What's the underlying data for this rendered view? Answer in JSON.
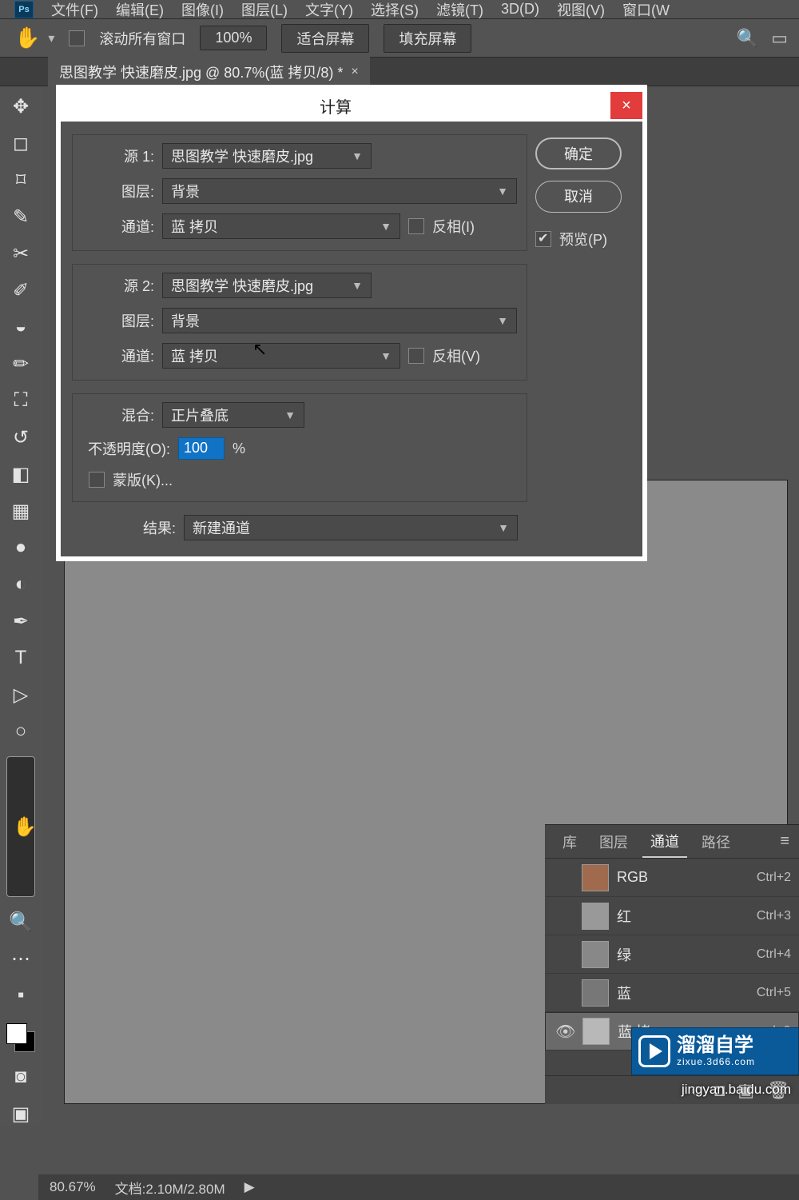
{
  "menubar": [
    "文件(F)",
    "编辑(E)",
    "图像(I)",
    "图层(L)",
    "文字(Y)",
    "选择(S)",
    "滤镜(T)",
    "3D(D)",
    "视图(V)",
    "窗口(W"
  ],
  "optbar": {
    "scroll_all": "滚动所有窗口",
    "zoom": "100%",
    "fit": "适合屏幕",
    "fill": "填充屏幕"
  },
  "doctab": {
    "title": "思图教学 快速磨皮.jpg @ 80.7%(蓝 拷贝/8) *",
    "close": "×"
  },
  "dialog": {
    "title": "计算",
    "close": "×",
    "source1_label": "源 1:",
    "source2_label": "源 2:",
    "source_file": "思图教学 快速磨皮.jpg",
    "layer_label": "图层:",
    "layer_value": "背景",
    "channel_label": "通道:",
    "channel_value": "蓝 拷贝",
    "invert1": "反相(I)",
    "invert2": "反相(V)",
    "blend_label": "混合:",
    "blend_value": "正片叠底",
    "opacity_label": "不透明度(O):",
    "opacity_value": "100",
    "percent": "%",
    "mask": "蒙版(K)...",
    "result_label": "结果:",
    "result_value": "新建通道",
    "ok": "确定",
    "cancel": "取消",
    "preview": "预览(P)"
  },
  "panels": {
    "tabs": [
      "库",
      "图层",
      "通道",
      "路径"
    ],
    "channels": [
      {
        "name": "RGB",
        "shortcut": "Ctrl+2",
        "thumb": "#a06a4e"
      },
      {
        "name": "红",
        "shortcut": "Ctrl+3",
        "thumb": "#999"
      },
      {
        "name": "绿",
        "shortcut": "Ctrl+4",
        "thumb": "#888"
      },
      {
        "name": "蓝",
        "shortcut": "Ctrl+5",
        "thumb": "#777"
      },
      {
        "name": "蓝 拷",
        "shortcut": "rl+6",
        "thumb": "#b8b8b8",
        "selected": true,
        "visible": true
      }
    ]
  },
  "watermark": {
    "brand": "溜溜自学",
    "sub": "zixue.3d66.com"
  },
  "wmurl": "jingyan.baidu.com",
  "status": {
    "zoom": "80.67%",
    "doc": "文档:2.10M/2.80M"
  }
}
